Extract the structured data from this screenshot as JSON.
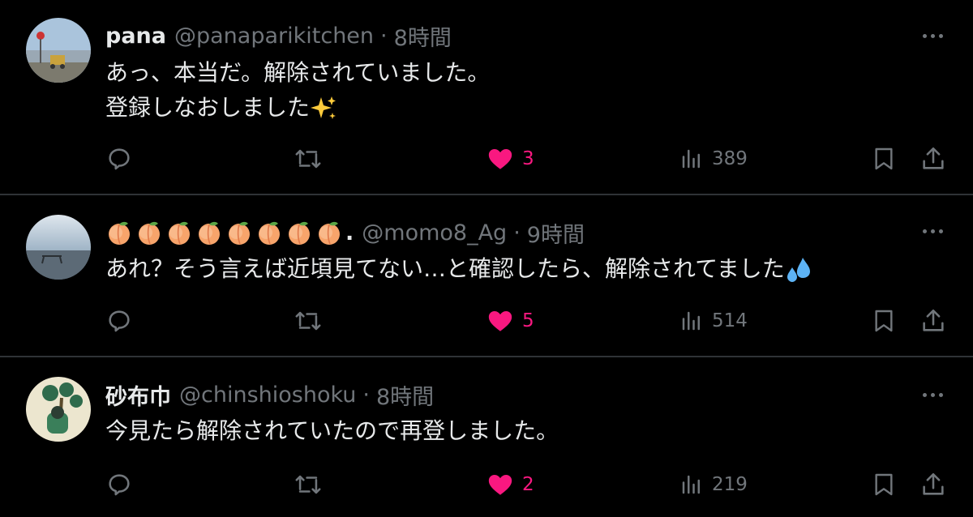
{
  "colors": {
    "background": "#000000",
    "text": "#e7e9ea",
    "muted": "#71767b",
    "like": "#f91880",
    "divider": "#2f3336"
  },
  "icons": {
    "reply": "reply-icon",
    "retweet": "retweet-icon",
    "like": "heart-icon",
    "views": "views-icon",
    "bookmark": "bookmark-icon",
    "share": "share-icon",
    "more": "more-icon"
  },
  "tweets": [
    {
      "name": "pana",
      "handle": "@panaparikitchen",
      "separator": "·",
      "time": "8時間",
      "lines": [
        "あっ、本当だ。解除されていました。",
        "登録しなおしました"
      ],
      "line2_emoji": "sparkles",
      "likes": "3",
      "views": "389"
    },
    {
      "name": ".",
      "name_emoji": "peach",
      "name_emoji_count": 8,
      "handle": "@momo8_Ag",
      "separator": "·",
      "time": "9時間",
      "lines": [
        "あれ？そう言えば近頃見てない…と確認したら、解除されてました"
      ],
      "line1_emoji": "sweat-droplets",
      "likes": "5",
      "views": "514"
    },
    {
      "name": "砂布巾",
      "handle": "@chinshioshoku",
      "separator": "·",
      "time": "8時間",
      "lines": [
        "今見たら解除されていたので再登しました。"
      ],
      "likes": "2",
      "views": "219"
    }
  ]
}
